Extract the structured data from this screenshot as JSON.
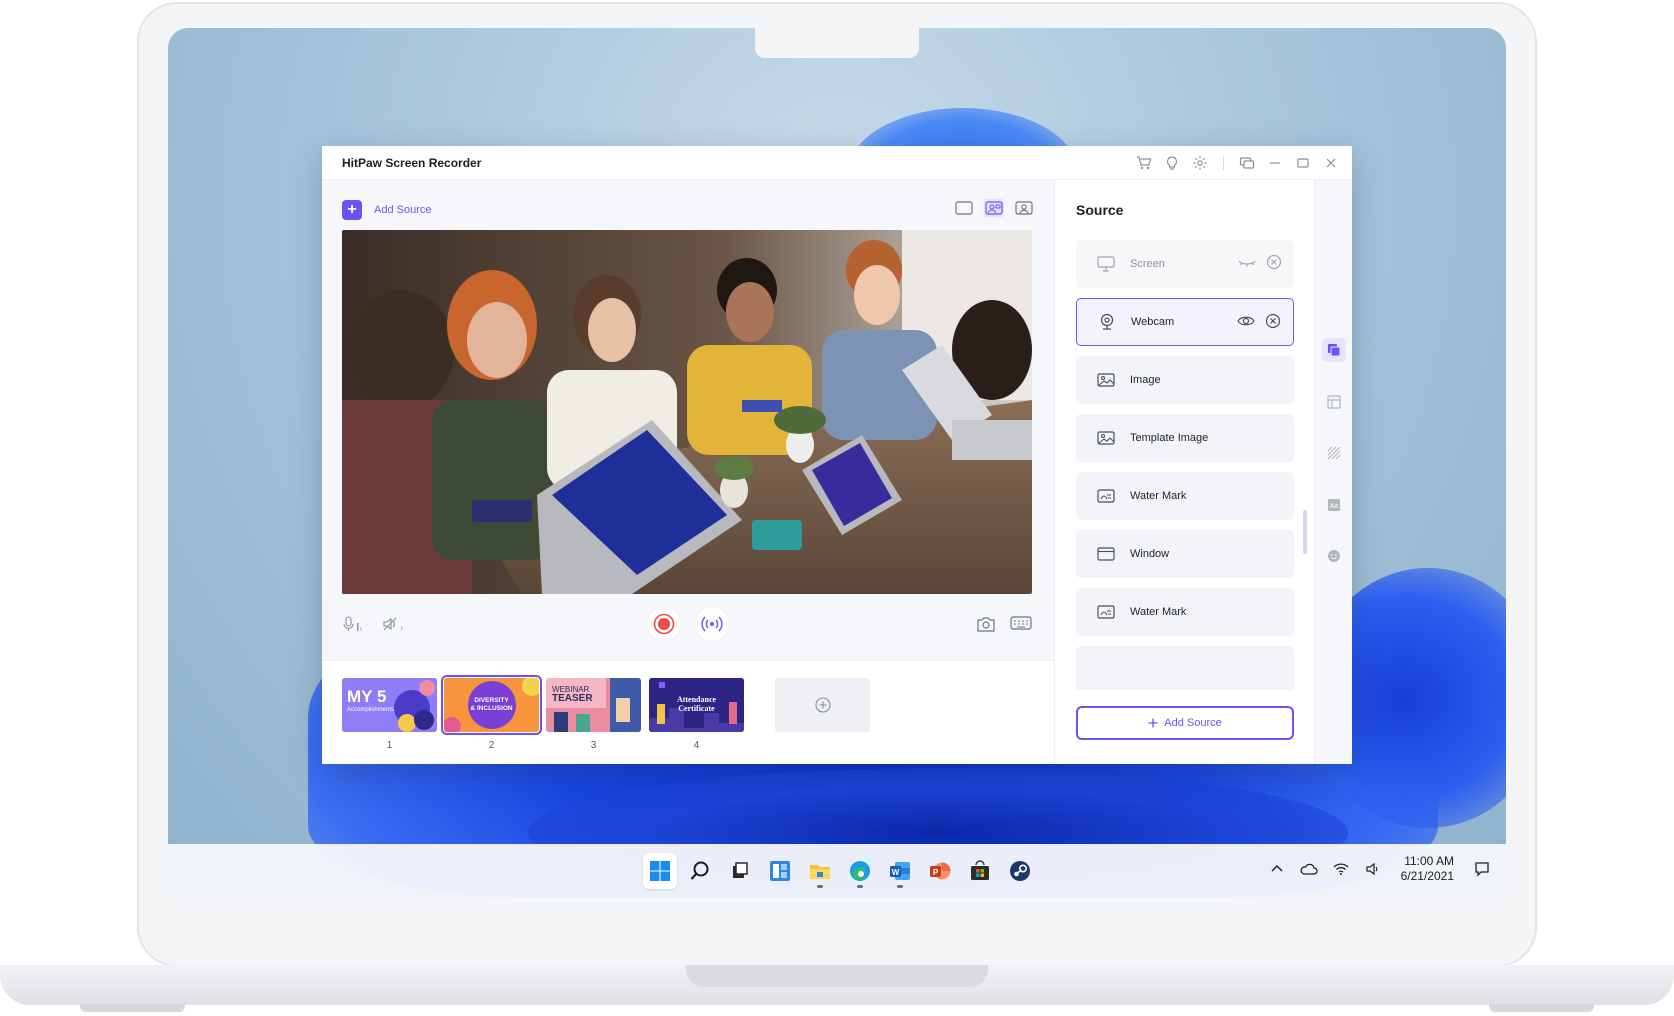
{
  "app": {
    "title": "HitPaw Screen Recorder",
    "title_tools": [
      "cart-icon",
      "bulb-icon",
      "gear-icon",
      "feedback-icon",
      "minimize-icon",
      "maximize-icon",
      "close-icon"
    ],
    "add_source_top": "Add Source",
    "layouts": [
      {
        "name": "screen-only",
        "selected": false
      },
      {
        "name": "screen-with-webcam",
        "selected": true
      },
      {
        "name": "webcam-only",
        "selected": false
      }
    ],
    "accent": "#6e52f5"
  },
  "scenes": [
    {
      "number": "1",
      "title_line1": "MY",
      "title_line2": "5",
      "title_line3": "Accomplishments",
      "selected": false
    },
    {
      "number": "2",
      "title_line1": "DIVERSITY",
      "title_line2": "& INCLUSION",
      "selected": true
    },
    {
      "number": "3",
      "title_line1": "WEBINAR",
      "title_line2": "TEASER",
      "selected": false
    },
    {
      "number": "4",
      "title_line1": "Attendance",
      "title_line2": "Certificate",
      "selected": false
    }
  ],
  "sources": {
    "title": "Source",
    "items": [
      {
        "label": "Screen",
        "icon": "monitor-icon",
        "state": "hidden"
      },
      {
        "label": "Webcam",
        "icon": "webcam-icon",
        "state": "selected"
      },
      {
        "label": "Image",
        "icon": "image-icon",
        "state": "normal"
      },
      {
        "label": "Template Image",
        "icon": "image-icon",
        "state": "normal"
      },
      {
        "label": "Water Mark",
        "icon": "watermark-icon",
        "state": "normal"
      },
      {
        "label": "Window",
        "icon": "window-icon",
        "state": "normal"
      },
      {
        "label": "Water Mark",
        "icon": "watermark-icon",
        "state": "normal"
      }
    ],
    "add_source_bottom": "Add Source"
  },
  "rail": [
    "sources-icon",
    "layout-icon",
    "background-icon",
    "text-icon",
    "sticker-icon"
  ],
  "taskbar": {
    "apps": [
      "start-icon",
      "search-icon",
      "task-view-icon",
      "widgets-icon",
      "file-explorer-icon",
      "edge-icon",
      "word-icon",
      "powerpoint-icon",
      "store-icon",
      "steam-icon"
    ],
    "time": "11:00 AM",
    "date": "6/21/2021"
  }
}
